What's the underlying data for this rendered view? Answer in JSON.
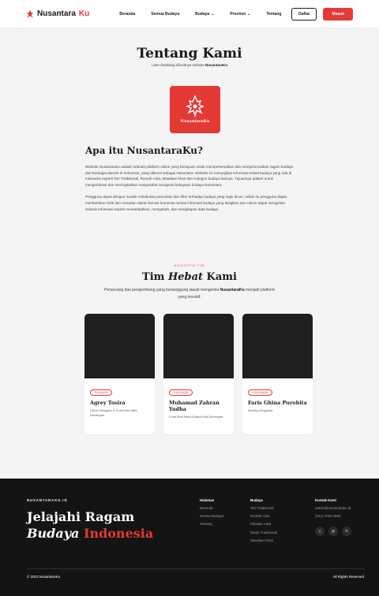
{
  "nav": {
    "brand_main": "Nusantara",
    "brand_accent": "Ku",
    "links": [
      "Beranda",
      "Semua Budaya",
      "Budaya",
      "Provinsi",
      "Tentang"
    ],
    "register_label": "Daftar",
    "login_label": "Masuk"
  },
  "hero": {
    "title": "Tentang Kami",
    "subtitle_prefix": "Latar belakang dibuatnya website ",
    "subtitle_bold": "NusantaraKu",
    "logo_label": "NusantaraKu"
  },
  "about": {
    "heading": "Apa itu NusantaraKu?",
    "p1": "Website NusantaraKu adalah sebuah platform online yang bertujuan untuk memperkenalkan dan mempromosikan ragam budaya dari berbagai daerah di Indonesia, yang dikenal sebagai Nusantara. Website ini menyajikan informasi terkait budaya yang ada di Indonesia seperti Tari Tradisional, Rumah Adat, Masakan khas dan Kategori budaya lainnya. Tujuannya adalah untuk mengedukasi dan meningkatkan masyarakat mengenai kekayaan budaya Nusantara.",
    "p2": "Pengguna dapat dengan mudah melakukan pencarian dan filter terhadap budaya yang ingin dicari, selain itu pengguna dapat memberikan kritik dan masukan dalam bentuk komentar terkait informasi budaya yang disajikan dan Admin dapat mengelola seluruh informasi seperti menambahkan, mengubah, dan menghapus data budaya."
  },
  "team": {
    "eyebrow": "ANGGOTA TIM",
    "title_a": "Tim ",
    "title_b": "Hebat",
    "title_c": " Kami",
    "desc_a": "Perancang dan pengembang yang bertanggung jawab mengelola ",
    "desc_b": "NusantaraKu",
    "desc_c": " menjadi platform yang inovatif.",
    "members": [
      {
        "id": "F0443003",
        "name": "Agrey Tosira",
        "role": "UI/UX Designer & Front-End Web Developer"
      },
      {
        "id": "F42315026",
        "name": "Muhamad Zahran Yudha",
        "role": "Front-End Web & Back-End Developer"
      },
      {
        "id": "G02314845",
        "name": "Faris Ghina Purohita",
        "role": "DevOps Engineer"
      }
    ]
  },
  "footer": {
    "eyebrow": "NUSANTARAKU.ID",
    "head_line1": "Jelajahi Ragam",
    "head_italic": "Budaya",
    "head_red": "Indonesia",
    "col1": {
      "title": "Halaman",
      "items": [
        "Beranda",
        "Semua Budaya",
        "Tentang"
      ]
    },
    "col2": {
      "title": "Budaya",
      "items": [
        "Tari Tradisional",
        "Rumah Adat",
        "Pakaian Adat",
        "Musik Tradisional",
        "Masakan Khas"
      ]
    },
    "col3": {
      "title": "Kontak Kami",
      "email": "admin@nusantaraku.id",
      "phone": "(021) 3753 0085"
    },
    "social_icons": [
      "facebook-icon",
      "instagram-icon",
      "x-icon"
    ],
    "copyright": "© 2023 NusantaraKu",
    "rights": "All Rights Reserved"
  },
  "colors": {
    "accent": "#e53935",
    "dark": "#141414",
    "background": "#f4f4f4"
  }
}
